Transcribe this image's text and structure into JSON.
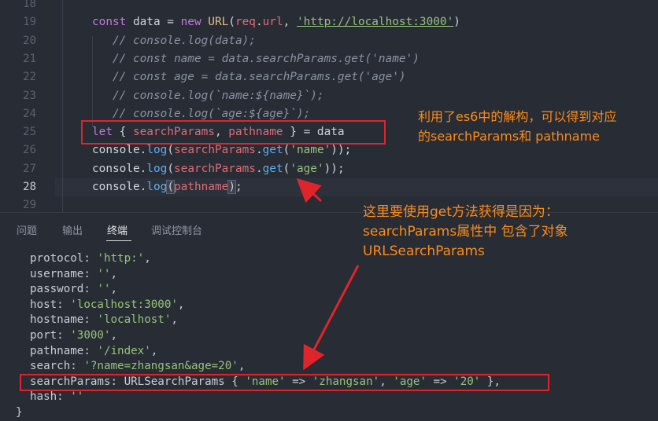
{
  "editor": {
    "line_numbers": [
      "18",
      "19",
      "20",
      "21",
      "22",
      "23",
      "24",
      "25",
      "26",
      "27",
      "28",
      "29"
    ],
    "lines": [
      {
        "segments": []
      },
      {
        "segments": [
          {
            "t": "const ",
            "c": "kw"
          },
          {
            "t": "data",
            "c": "txt"
          },
          {
            "t": " = ",
            "c": "txt"
          },
          {
            "t": "new ",
            "c": "kw"
          },
          {
            "t": "URL",
            "c": "ty"
          },
          {
            "t": "(",
            "c": "txt"
          },
          {
            "t": "req",
            "c": "var"
          },
          {
            "t": ".",
            "c": "txt"
          },
          {
            "t": "url",
            "c": "var"
          },
          {
            "t": ", ",
            "c": "txt"
          },
          {
            "t": "'http://localhost:3000'",
            "c": "str"
          },
          {
            "t": ")",
            "c": "txt"
          }
        ]
      },
      {
        "segments": [
          {
            "t": "   // console.log(data);",
            "c": "cm"
          }
        ]
      },
      {
        "segments": [
          {
            "t": "   // const name = data.searchParams.get('name')",
            "c": "cm"
          }
        ]
      },
      {
        "segments": [
          {
            "t": "   // const age = data.searchParams.get('age')",
            "c": "cm"
          }
        ]
      },
      {
        "segments": [
          {
            "t": "   // console.log(`name:${name}`);",
            "c": "cm"
          }
        ]
      },
      {
        "segments": [
          {
            "t": "   // console.log(`age:${age}`);",
            "c": "cm"
          }
        ]
      },
      {
        "segments": [
          {
            "t": "let ",
            "c": "kw"
          },
          {
            "t": "{ ",
            "c": "txt"
          },
          {
            "t": "searchParams",
            "c": "var"
          },
          {
            "t": ", ",
            "c": "txt"
          },
          {
            "t": "pathname",
            "c": "var"
          },
          {
            "t": " } = ",
            "c": "txt"
          },
          {
            "t": "data",
            "c": "txt"
          }
        ]
      },
      {
        "segments": [
          {
            "t": "console",
            "c": "txt"
          },
          {
            "t": ".",
            "c": "txt"
          },
          {
            "t": "log",
            "c": "fn"
          },
          {
            "t": "(",
            "c": "txt"
          },
          {
            "t": "searchParams",
            "c": "var"
          },
          {
            "t": ".",
            "c": "txt"
          },
          {
            "t": "get",
            "c": "fn"
          },
          {
            "t": "(",
            "c": "txt"
          },
          {
            "t": "'name'",
            "c": "s2"
          },
          {
            "t": "));",
            "c": "txt"
          }
        ]
      },
      {
        "segments": [
          {
            "t": "console",
            "c": "txt"
          },
          {
            "t": ".",
            "c": "txt"
          },
          {
            "t": "log",
            "c": "fn"
          },
          {
            "t": "(",
            "c": "txt"
          },
          {
            "t": "searchParams",
            "c": "var"
          },
          {
            "t": ".",
            "c": "txt"
          },
          {
            "t": "get",
            "c": "fn"
          },
          {
            "t": "(",
            "c": "txt"
          },
          {
            "t": "'age'",
            "c": "s2"
          },
          {
            "t": "));",
            "c": "txt"
          }
        ]
      },
      {
        "segments": [
          {
            "t": "console",
            "c": "txt"
          },
          {
            "t": ".",
            "c": "txt"
          },
          {
            "t": "log",
            "c": "fn"
          },
          {
            "t": "(",
            "c": "paren-hl"
          },
          {
            "t": "pathname",
            "c": "var"
          },
          {
            "t": ")",
            "c": "paren-hl"
          },
          {
            "t": ";",
            "c": "txt"
          }
        ]
      },
      {
        "segments": []
      }
    ]
  },
  "annotations": {
    "note1_line1": "利用了es6中的解构，可以得到对应",
    "note1_line2": "的searchParams和 pathname",
    "note2_line1": "这里要使用get方法获得是因为：",
    "note2_line2": "searchParams属性中 包含了对象",
    "note2_line3": "URLSearchParams"
  },
  "panel": {
    "tabs": [
      "问题",
      "输出",
      "终端",
      "调试控制台"
    ],
    "active_tab": "终端"
  },
  "terminal": {
    "lines": [
      [
        {
          "t": "protocol: ",
          "c": "key"
        },
        {
          "t": "'http:'",
          "c": "tstr"
        },
        {
          "t": ",",
          "c": "key"
        }
      ],
      [
        {
          "t": "username: ",
          "c": "key"
        },
        {
          "t": "''",
          "c": "tstr"
        },
        {
          "t": ",",
          "c": "key"
        }
      ],
      [
        {
          "t": "password: ",
          "c": "key"
        },
        {
          "t": "''",
          "c": "tstr"
        },
        {
          "t": ",",
          "c": "key"
        }
      ],
      [
        {
          "t": "host: ",
          "c": "key"
        },
        {
          "t": "'localhost:3000'",
          "c": "tstr"
        },
        {
          "t": ",",
          "c": "key"
        }
      ],
      [
        {
          "t": "hostname: ",
          "c": "key"
        },
        {
          "t": "'localhost'",
          "c": "tstr"
        },
        {
          "t": ",",
          "c": "key"
        }
      ],
      [
        {
          "t": "port: ",
          "c": "key"
        },
        {
          "t": "'3000'",
          "c": "tstr"
        },
        {
          "t": ",",
          "c": "key"
        }
      ],
      [
        {
          "t": "pathname: ",
          "c": "key"
        },
        {
          "t": "'/index'",
          "c": "tstr"
        },
        {
          "t": ",",
          "c": "key"
        }
      ],
      [
        {
          "t": "search: ",
          "c": "key"
        },
        {
          "t": "'?name=zhangsan&age=20'",
          "c": "tstr"
        },
        {
          "t": ",",
          "c": "key"
        }
      ],
      [
        {
          "t": "searchParams: URLSearchParams { ",
          "c": "key"
        },
        {
          "t": "'name'",
          "c": "tstr"
        },
        {
          "t": " => ",
          "c": "key"
        },
        {
          "t": "'zhangsan'",
          "c": "tstr"
        },
        {
          "t": ", ",
          "c": "key"
        },
        {
          "t": "'age'",
          "c": "tstr"
        },
        {
          "t": " => ",
          "c": "key"
        },
        {
          "t": "'20'",
          "c": "tstr"
        },
        {
          "t": " },",
          "c": "key"
        }
      ],
      [
        {
          "t": "hash: ",
          "c": "key"
        },
        {
          "t": "''",
          "c": "tstr"
        }
      ]
    ],
    "closing_brace": "}"
  },
  "colors": {
    "background": "#272c35",
    "annotation": "#ff8c1a",
    "highlight_box": "#e0242b"
  }
}
